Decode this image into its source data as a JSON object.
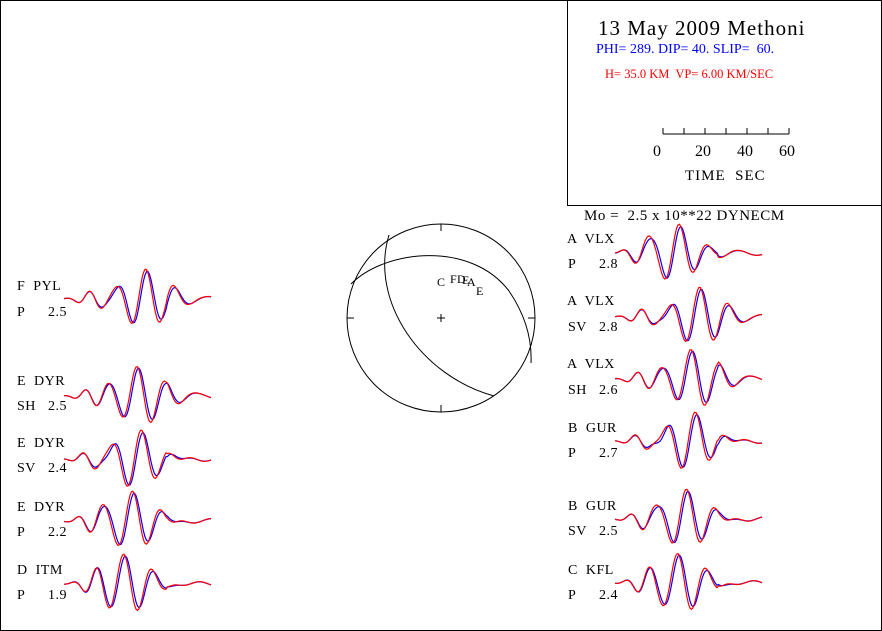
{
  "header": {
    "title": "13 May 2009 Methoni",
    "mechanism": "PHI= 289. DIP= 40. SLIP=  60.",
    "depth_velocity": "H= 35.0 KM  VP= 6.00 KM/SEC",
    "moment": "Mo =  2.5 x 10**22 DYNECM"
  },
  "time_scale": {
    "ticks": [
      "0",
      "20",
      "40",
      "60"
    ],
    "label": "TIME  SEC",
    "max_seconds": 60
  },
  "colors": {
    "observed": "#0000ff",
    "synthetic": "#ff0000",
    "mechanism_text": "#0000ff",
    "depth_text": "#ff0000"
  },
  "focal_sphere": {
    "station_marks": [
      "C",
      "F",
      "D",
      "E",
      "A",
      "E"
    ]
  },
  "stations": {
    "left": [
      {
        "code": "F  PYL",
        "phase": "P",
        "value": "2.5"
      },
      {
        "code": "E  DYR",
        "phase": "SH",
        "value": "2.5"
      },
      {
        "code": "E  DYR",
        "phase": "SV",
        "value": "2.4"
      },
      {
        "code": "E  DYR",
        "phase": "P",
        "value": "2.2"
      },
      {
        "code": "D  ITM",
        "phase": "P",
        "value": "1.9"
      }
    ],
    "right": [
      {
        "code": "A  VLX",
        "phase": "P",
        "value": "2.8"
      },
      {
        "code": "A  VLX",
        "phase": "SV",
        "value": "2.8"
      },
      {
        "code": "A  VLX",
        "phase": "SH",
        "value": "2.6"
      },
      {
        "code": "B  GUR",
        "phase": "P",
        "value": "2.7"
      },
      {
        "code": "B  GUR",
        "phase": "SV",
        "value": "2.5"
      },
      {
        "code": "C  KFL",
        "phase": "P",
        "value": "2.4"
      }
    ]
  }
}
